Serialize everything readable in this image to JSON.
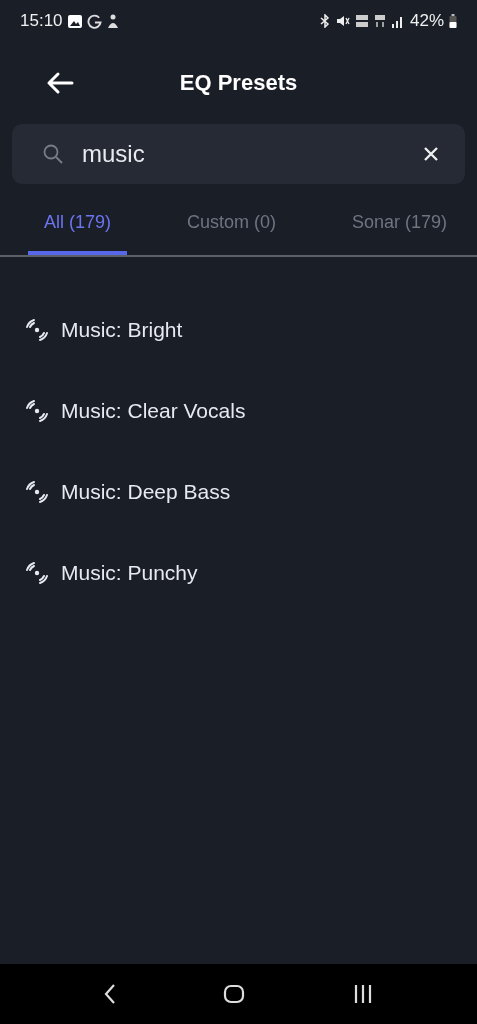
{
  "status_bar": {
    "time": "15:10",
    "battery": "42%"
  },
  "header": {
    "title": "EQ Presets"
  },
  "search": {
    "value": "music"
  },
  "tabs": [
    {
      "label": "All (179)",
      "selected": true
    },
    {
      "label": "Custom (0)",
      "selected": false
    },
    {
      "label": "Sonar (179)",
      "selected": false
    }
  ],
  "presets": [
    {
      "name": "Music: Bright"
    },
    {
      "name": "Music: Clear Vocals"
    },
    {
      "name": "Music: Deep Bass"
    },
    {
      "name": "Music: Punchy"
    }
  ]
}
